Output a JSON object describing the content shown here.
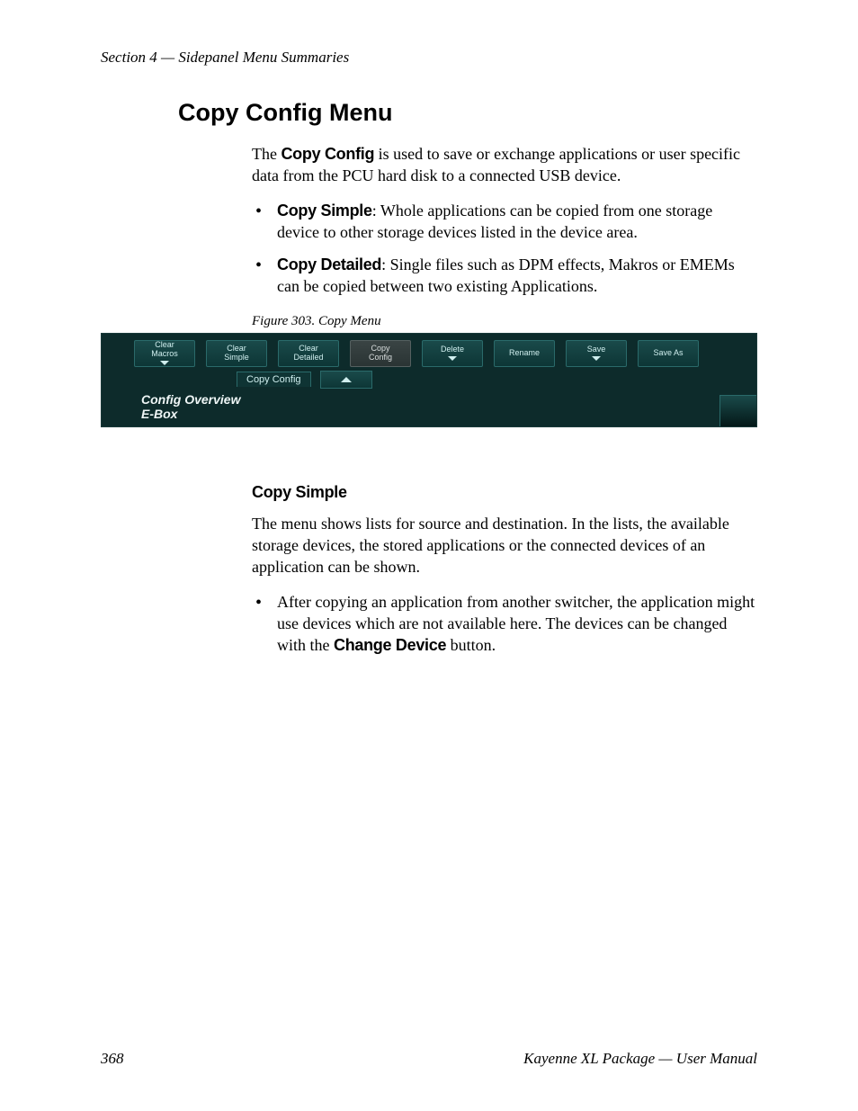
{
  "header": {
    "text": "Section 4 — Sidepanel Menu Summaries"
  },
  "title": "Copy Config Menu",
  "intro": {
    "lead_bold": "Copy Config",
    "lead_pre": "The ",
    "lead_post": " is used to save or exchange applications or user specific data from the PCU hard disk to a connected USB device."
  },
  "bullets1": [
    {
      "bold": "Copy Simple",
      "text": ": Whole applications can be copied from one storage device to other storage devices listed in the device area."
    },
    {
      "bold": "Copy Detailed",
      "text": ": Single files such as DPM effects, Makros or EMEMs can be copied between two existing Applications."
    }
  ],
  "figure": {
    "caption": "Figure 303.  Copy Menu",
    "buttons": [
      {
        "l1": "Clear",
        "l2": "Macros",
        "dd": true,
        "grey": false
      },
      {
        "l1": "Clear",
        "l2": "Simple",
        "dd": false,
        "grey": false
      },
      {
        "l1": "Clear",
        "l2": "Detailed",
        "dd": false,
        "grey": false
      },
      {
        "l1": "Copy",
        "l2": "Config",
        "dd": false,
        "grey": true
      },
      {
        "l1": "Delete",
        "l2": "",
        "dd": true,
        "grey": false
      },
      {
        "l1": "Rename",
        "l2": "",
        "dd": false,
        "grey": false
      },
      {
        "l1": "Save",
        "l2": "",
        "dd": true,
        "grey": false
      },
      {
        "l1": "Save As",
        "l2": "",
        "dd": false,
        "grey": false
      }
    ],
    "tab": "Copy Config",
    "overview": "Config Overview",
    "ebox": "E-Box"
  },
  "sub": {
    "heading": "Copy Simple",
    "para": "The menu shows lists for source and destination. In the lists, the available storage devices, the stored applications or the connected devices of an application can be shown.",
    "bullet_pre": "After copying an application from another switcher, the application might use devices which are not available here. The devices can be changed with the ",
    "bullet_bold": "Change Device",
    "bullet_post": " button."
  },
  "footer": {
    "pageno": "368",
    "right": "Kayenne XL Package — User Manual"
  }
}
